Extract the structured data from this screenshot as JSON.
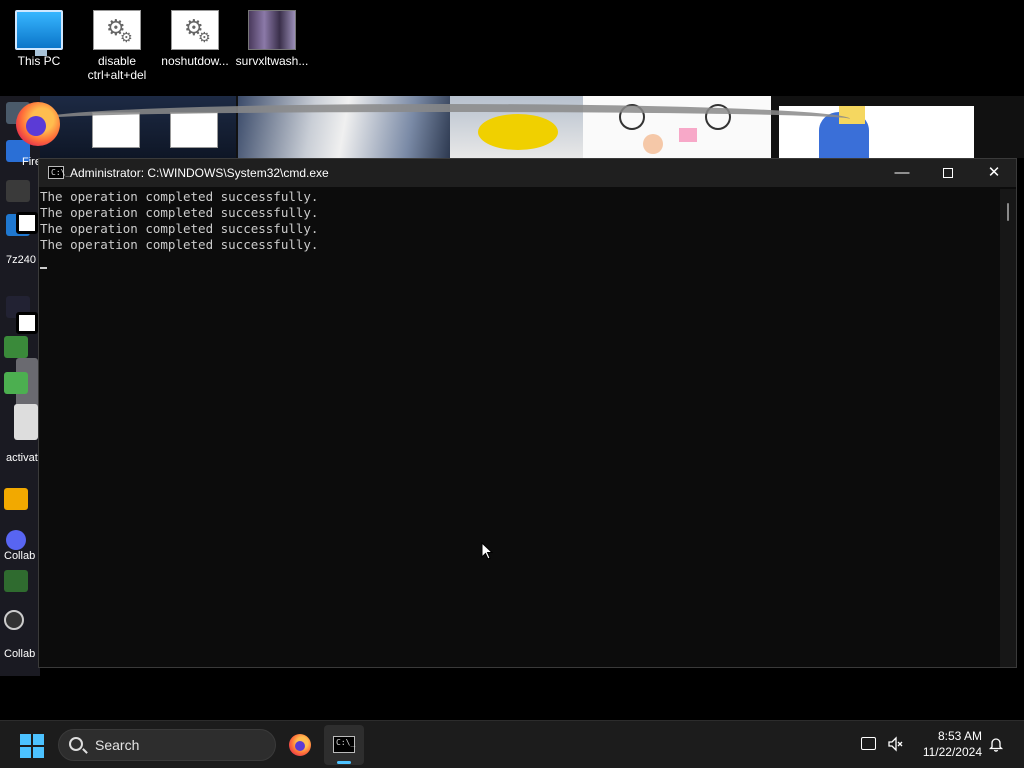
{
  "desktop": {
    "top_icons": [
      {
        "label": "This PC",
        "icon": "this-pc-icon"
      },
      {
        "label": "disable\nctrl+alt+del",
        "icon": "settings-shortcut-icon"
      },
      {
        "label": "noshutdow...",
        "icon": "settings-shortcut-icon"
      },
      {
        "label": "survxltwash...",
        "icon": "image-file-icon"
      }
    ],
    "left_labels": [
      "Fire",
      "7z240",
      "activat",
      "Collab",
      "Collab"
    ]
  },
  "cmd_window": {
    "title": "Administrator: C:\\WINDOWS\\System32\\cmd.exe",
    "icon_glyph": "C:\\_",
    "minimize_glyph": "—",
    "close_glyph": "✕",
    "output_lines": [
      "The operation completed successfully.",
      "The operation completed successfully.",
      "The operation completed successfully.",
      "The operation completed successfully."
    ]
  },
  "taskbar": {
    "search_label": "Search",
    "apps": [
      {
        "name": "Firefox",
        "icon": "firefox-icon"
      },
      {
        "name": "Command Prompt",
        "icon": "cmd-icon",
        "active": true
      }
    ],
    "tray": {
      "time": "8:53 AM",
      "date": "11/22/2024"
    }
  },
  "colors": {
    "accent": "#4cc2ff",
    "console_text": "#cccccc",
    "console_bg": "#0c0c0c",
    "titlebar_bg": "#1f1f1f",
    "taskbar_bg": "#1c1c1c"
  }
}
